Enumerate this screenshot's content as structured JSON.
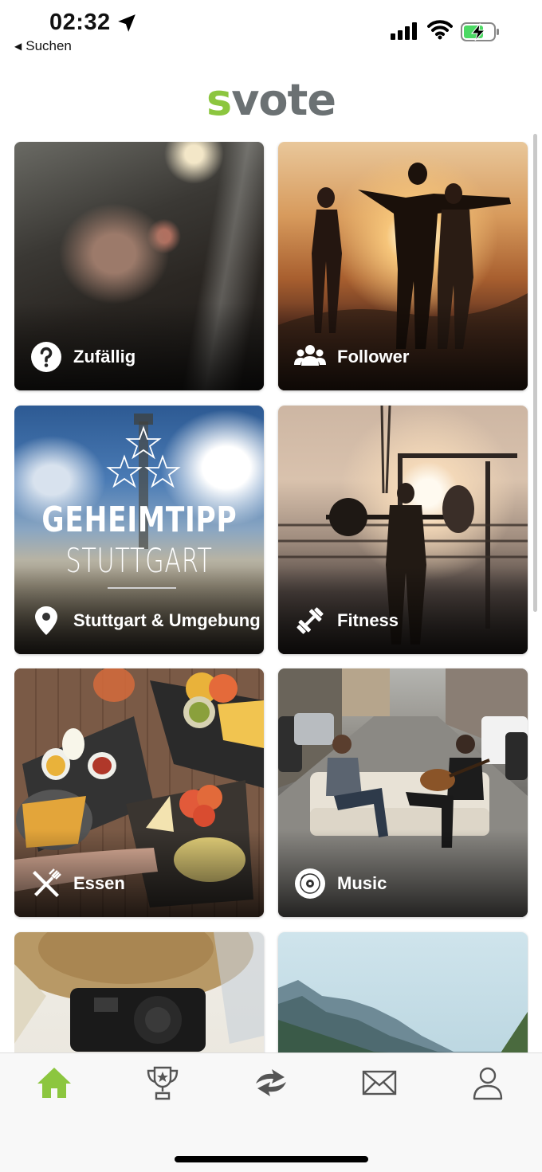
{
  "status_bar": {
    "time": "02:32",
    "back_label": "Suchen"
  },
  "logo": {
    "first_letter": "s",
    "rest": "vote",
    "accent_color": "#8cc63f",
    "text_color": "#6b7173"
  },
  "categories": [
    {
      "label": "Zufällig",
      "icon": "question-circle-icon"
    },
    {
      "label": "Follower",
      "icon": "people-icon"
    },
    {
      "label": "Stuttgart & Umgebung",
      "icon": "location-pin-icon"
    },
    {
      "label": "Fitness",
      "icon": "dumbbell-icon"
    },
    {
      "label": "Essen",
      "icon": "fork-knife-icon"
    },
    {
      "label": "Music",
      "icon": "vinyl-disc-icon"
    }
  ],
  "geheimtipp": {
    "title": "GEHEIMTIPP",
    "subtitle": "STUTTGART"
  },
  "tab_bar": {
    "items": [
      "home-icon",
      "trophy-icon",
      "svote-swap-icon",
      "mail-icon",
      "profile-icon"
    ],
    "active": "home-icon",
    "active_color": "#8cc63f",
    "inactive_color": "#555555"
  }
}
